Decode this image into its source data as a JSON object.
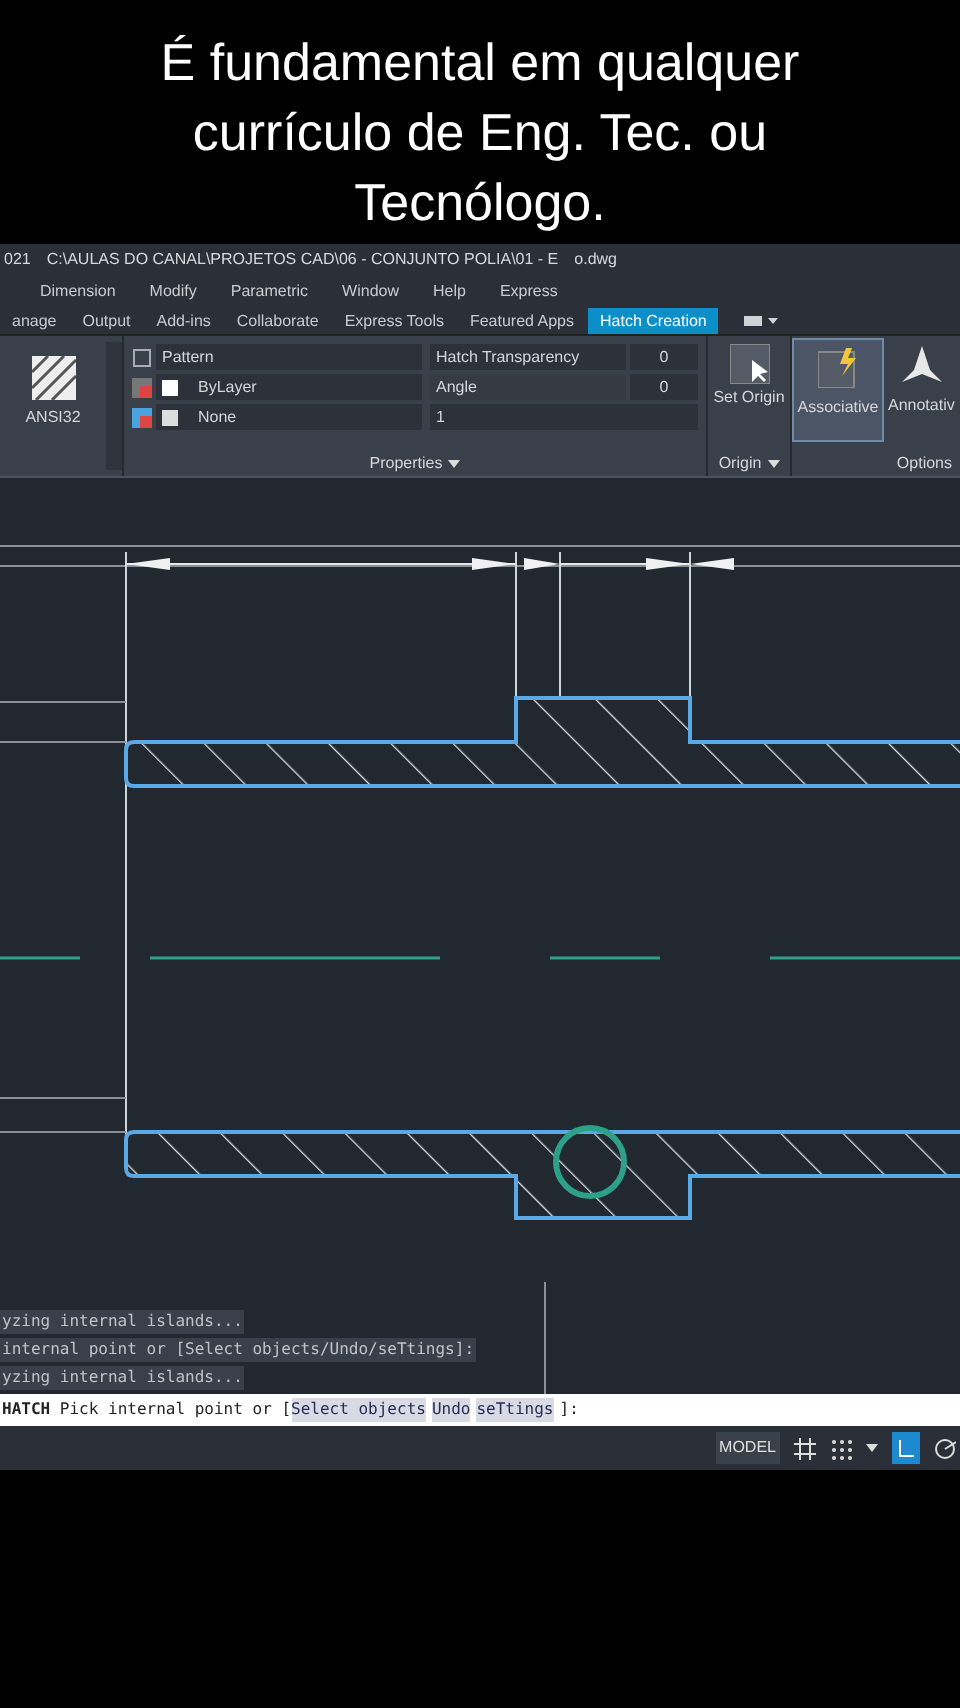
{
  "caption": "É fundamental em qualquer currículo de Eng. Tec. ou Tecnólogo.",
  "title_bar": {
    "version": "021",
    "path": "C:\\AULAS DO CANAL\\PROJETOS CAD\\06 - CONJUNTO POLIA\\01 - E",
    "path_end": "o.dwg"
  },
  "menu": [
    "Dimension",
    "Modify",
    "Parametric",
    "Window",
    "Help",
    "Express"
  ],
  "ribbon_tabs": [
    {
      "label": "anage",
      "selected": false
    },
    {
      "label": "Output",
      "selected": false
    },
    {
      "label": "Add-ins",
      "selected": false
    },
    {
      "label": "Collaborate",
      "selected": false
    },
    {
      "label": "Express Tools",
      "selected": false
    },
    {
      "label": "Featured Apps",
      "selected": false
    },
    {
      "label": "Hatch Creation",
      "selected": true
    }
  ],
  "hatch_panel": {
    "pattern": "ANSI32",
    "type": "Pattern",
    "hatch_color_name": "ByLayer",
    "background": "None",
    "transparency_label": "Hatch Transparency",
    "transparency": "0",
    "angle_label": "Angle",
    "angle": "0",
    "scale": "1",
    "properties_label": "Properties",
    "origin_label": "Origin",
    "options_label": "Options",
    "set_origin": "Set Origin",
    "associative": {
      "label": "Associative",
      "selected": true
    },
    "annotative": "Annotativ"
  },
  "command_history": [
    "yzing internal islands...",
    "internal point or [Select objects/Undo/seTtings]:",
    "yzing internal islands..."
  ],
  "command_line": {
    "command": "HATCH",
    "segments": [
      {
        "text": "Pick internal point or [",
        "kind": "plain"
      },
      {
        "text": "Select objects",
        "kind": "option"
      },
      {
        "text": "Undo",
        "kind": "option"
      },
      {
        "text": "seTtings",
        "kind": "option"
      },
      {
        "text": "]:",
        "kind": "plain"
      }
    ]
  },
  "status_bar": {
    "mode": "MODEL"
  }
}
